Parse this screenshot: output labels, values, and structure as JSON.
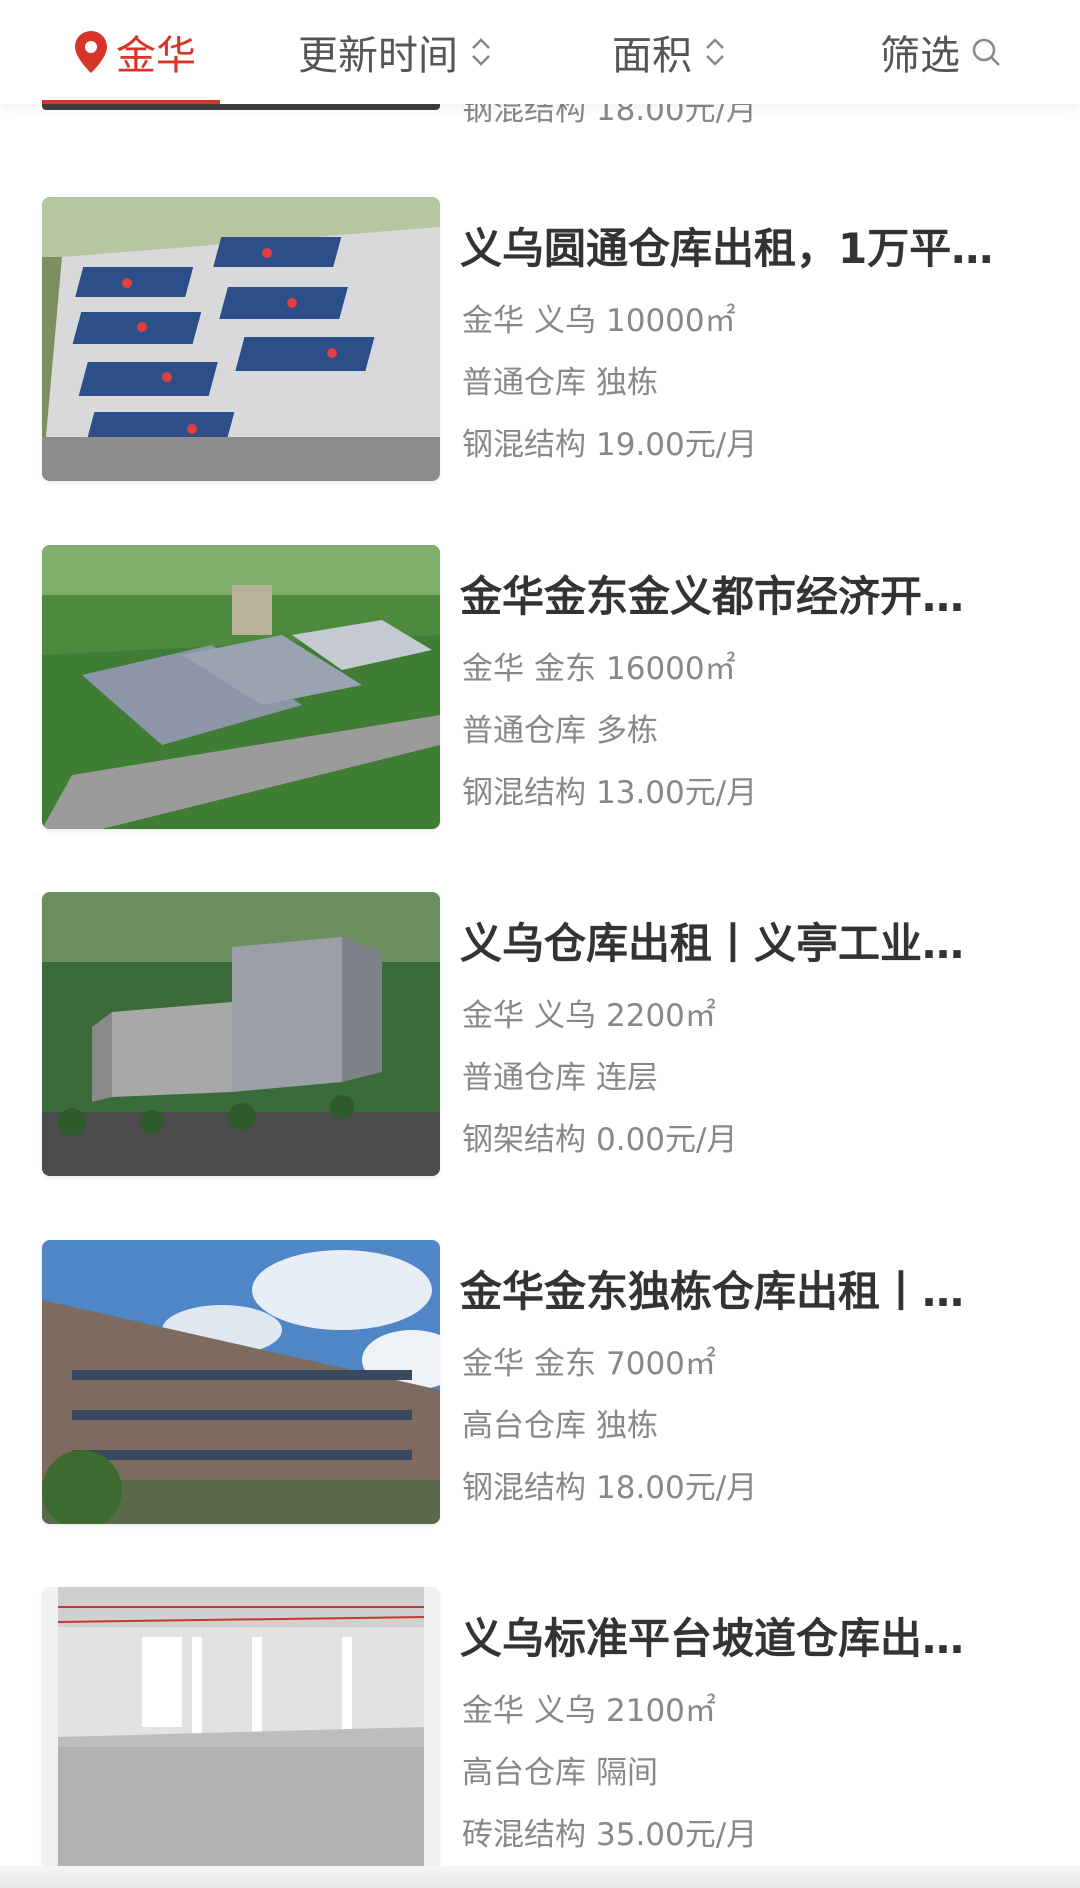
{
  "filter_bar": {
    "location": "金华",
    "update_time": "更新时间",
    "area": "面积",
    "filter": "筛选"
  },
  "partial_listing": {
    "text": "钢混结构 18.00元/月"
  },
  "listings": [
    {
      "title": "义乌圆通仓库出租，1万平…",
      "city": "金华",
      "district": "义乌",
      "area": "10000㎡",
      "type": "普通仓库",
      "building": "独栋",
      "structure": "钢混结构",
      "price": "19.00元/月"
    },
    {
      "title": "金华金东金义都市经济开…",
      "city": "金华",
      "district": "金东",
      "area": "16000㎡",
      "type": "普通仓库",
      "building": "多栋",
      "structure": "钢混结构",
      "price": "13.00元/月"
    },
    {
      "title": "义乌仓库出租丨义亭工业…",
      "city": "金华",
      "district": "义乌",
      "area": "2200㎡",
      "type": "普通仓库",
      "building": "连层",
      "structure": "钢架结构",
      "price": "0.00元/月"
    },
    {
      "title": "金华金东独栋仓库出租丨…",
      "city": "金华",
      "district": "金东",
      "area": "7000㎡",
      "type": "高台仓库",
      "building": "独栋",
      "structure": "钢混结构",
      "price": "18.00元/月"
    },
    {
      "title": "义乌标准平台坡道仓库出…",
      "city": "金华",
      "district": "义乌",
      "area": "2100㎡",
      "type": "高台仓库",
      "building": "隔间",
      "structure": "砖混结构",
      "price": "35.00元/月"
    }
  ],
  "colors": {
    "accent": "#d8352a",
    "title": "#333333",
    "meta": "#888888"
  }
}
